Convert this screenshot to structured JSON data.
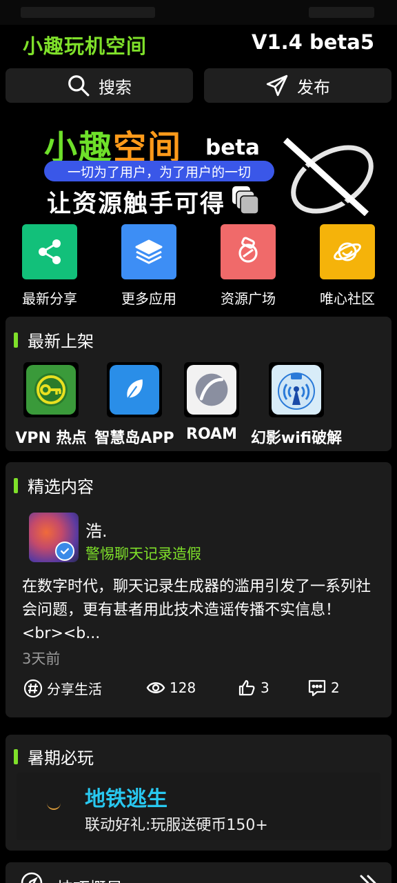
{
  "header": {
    "app_title": "小趣玩机空间",
    "version": "V1.4 beta5"
  },
  "toolbar": {
    "search_label": "搜索",
    "publish_label": "发布"
  },
  "banner": {
    "title_part1": "小趣",
    "title_part2": "空间",
    "beta": "beta",
    "tagline": "一切为了用户，为了用户的一切",
    "slogan": "让资源触手可得"
  },
  "quick_actions": [
    {
      "label": "最新分享",
      "icon": "share-icon",
      "color": "#12c07a"
    },
    {
      "label": "更多应用",
      "icon": "layers-icon",
      "color": "#3d8ef5"
    },
    {
      "label": "资源广场",
      "icon": "ring-icon",
      "color": "#f06a6a"
    },
    {
      "label": "唯心社区",
      "icon": "planet-icon",
      "color": "#f5b30a"
    }
  ],
  "new_apps": {
    "title": "最新上架",
    "items": [
      {
        "name": "VPN 热点",
        "icon": "key-icon",
        "color": "#3a9a3a"
      },
      {
        "name": "智慧岛APP",
        "icon": "leaf-icon",
        "color": "#2a8ee8"
      },
      {
        "name": "ROAM",
        "icon": "roam-icon",
        "color": "#f2f2f2"
      },
      {
        "name": "幻影wifi破解",
        "icon": "wifi-icon",
        "color": "#d8ecf8"
      }
    ]
  },
  "featured": {
    "title": "精选内容",
    "post": {
      "author": "浩.",
      "tag": "警惕聊天记录造假",
      "body": "在数字时代，聊天记录生成器的滥用引发了一系列社会问题，更有甚者用此技术造谣传播不实信息！<br><b...",
      "time": "3天前",
      "category": "分享生活",
      "views": "128",
      "likes": "3",
      "comments": "2"
    }
  },
  "summer": {
    "title": "暑期必玩",
    "game_title": "地铁逃生",
    "game_subtitle": "联动好礼:玩服送硬币150+"
  },
  "bottom": {
    "title": "技巧概显"
  },
  "colors": {
    "accent": "#7fe02a",
    "card": "#1c1c1c",
    "game_title": "#28c8f0"
  }
}
